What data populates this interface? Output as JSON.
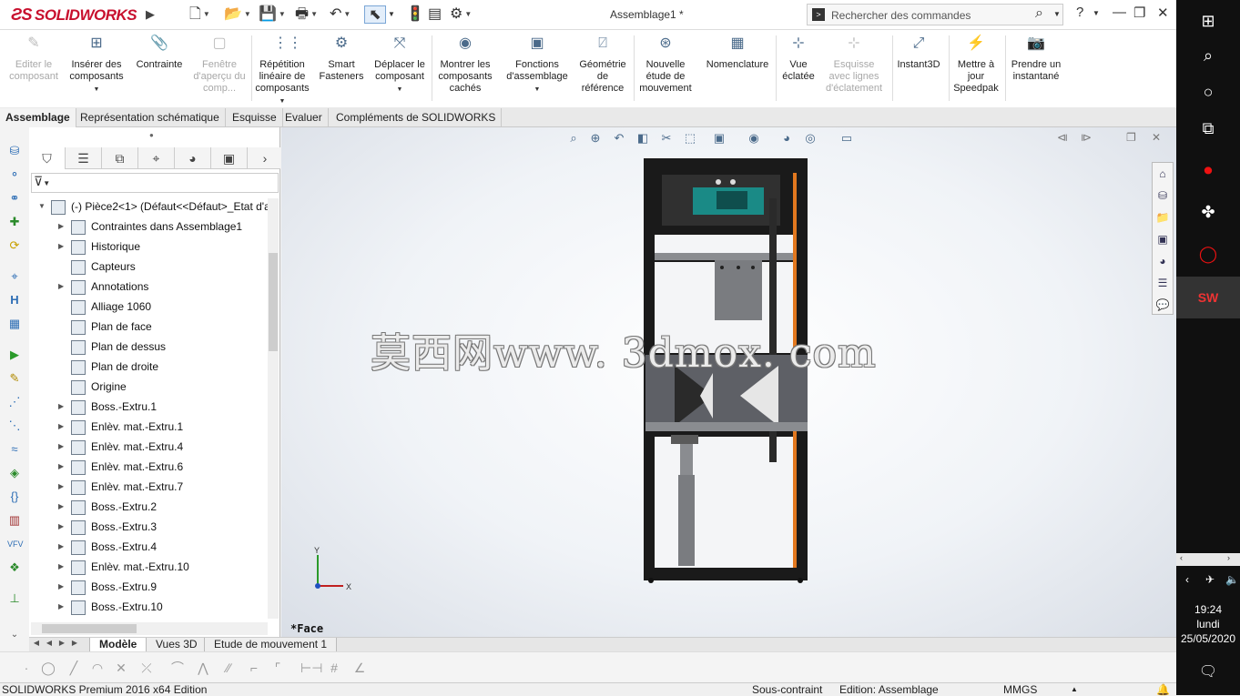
{
  "app": {
    "brand": "SOLIDWORKS",
    "document_title": "Assemblage1 *",
    "search_placeholder": "Rechercher des commandes",
    "help": "?"
  },
  "ribbon": [
    {
      "id": "edit",
      "label": "Editer le composant",
      "disabled": true
    },
    {
      "id": "insert",
      "label": "Insérer des composants",
      "disabled": false
    },
    {
      "id": "mate",
      "label": "Contrainte",
      "disabled": false
    },
    {
      "id": "preview",
      "label": "Fenêtre d'aperçu du comp...",
      "disabled": true
    },
    {
      "id": "pattern",
      "label": "Répétition linéaire de composants",
      "disabled": false
    },
    {
      "id": "fasteners",
      "label": "Smart Fasteners",
      "disabled": false
    },
    {
      "id": "move",
      "label": "Déplacer le composant",
      "disabled": false
    },
    {
      "id": "hidden",
      "label": "Montrer les composants cachés",
      "disabled": false
    },
    {
      "id": "features",
      "label": "Fonctions d'assemblage",
      "disabled": false
    },
    {
      "id": "refgeom",
      "label": "Géométrie de référence",
      "disabled": false
    },
    {
      "id": "motion",
      "label": "Nouvelle étude de mouvement",
      "disabled": false
    },
    {
      "id": "bom",
      "label": "Nomenclature",
      "disabled": false
    },
    {
      "id": "exploded",
      "label": "Vue éclatée",
      "disabled": false
    },
    {
      "id": "explodelines",
      "label": "Esquisse avec lignes d'éclatement",
      "disabled": true
    },
    {
      "id": "instant3d",
      "label": "Instant3D",
      "disabled": false
    },
    {
      "id": "speedpak",
      "label": "Mettre à jour Speedpak",
      "disabled": false
    },
    {
      "id": "snapshot",
      "label": "Prendre un instantané",
      "disabled": false
    }
  ],
  "cm_tabs": [
    "Assemblage",
    "Représentation schématique",
    "Esquisse",
    "Evaluer",
    "Compléments de SOLIDWORKS"
  ],
  "tree": {
    "root": "(-) Pièce2<1> (Défaut<<Défaut>_Etat d'a",
    "items": [
      {
        "label": "Contraintes dans Assemblage1",
        "expand": true
      },
      {
        "label": "Historique",
        "expand": true
      },
      {
        "label": "Capteurs",
        "expand": false
      },
      {
        "label": "Annotations",
        "expand": true
      },
      {
        "label": "Alliage 1060",
        "expand": false
      },
      {
        "label": "Plan de face",
        "expand": false
      },
      {
        "label": "Plan de dessus",
        "expand": false
      },
      {
        "label": "Plan de droite",
        "expand": false
      },
      {
        "label": "Origine",
        "expand": false
      },
      {
        "label": "Boss.-Extru.1",
        "expand": true
      },
      {
        "label": "Enlèv. mat.-Extru.1",
        "expand": true
      },
      {
        "label": "Enlèv. mat.-Extru.4",
        "expand": true
      },
      {
        "label": "Enlèv. mat.-Extru.6",
        "expand": true
      },
      {
        "label": "Enlèv. mat.-Extru.7",
        "expand": true
      },
      {
        "label": "Boss.-Extru.2",
        "expand": true
      },
      {
        "label": "Boss.-Extru.3",
        "expand": true
      },
      {
        "label": "Boss.-Extru.4",
        "expand": true
      },
      {
        "label": "Enlèv. mat.-Extru.10",
        "expand": true
      },
      {
        "label": "Boss.-Extru.9",
        "expand": true
      },
      {
        "label": "Boss.-Extru.10",
        "expand": true
      }
    ]
  },
  "viewport": {
    "watermark": "莫西网www. 3dmox. com",
    "view_name": "*Face",
    "axis_x": "X",
    "axis_y": "Y"
  },
  "model_tabs": [
    "Modèle",
    "Vues 3D",
    "Etude de mouvement 1"
  ],
  "status": {
    "product": "SOLIDWORKS Premium 2016 x64 Edition",
    "constraint": "Sous-contraint",
    "mode": "Edition: Assemblage",
    "units": "MMGS"
  },
  "taskbar": {
    "time": "19:24",
    "day": "lundi",
    "date": "25/05/2020"
  },
  "colors": {
    "brand": "#c8102e",
    "frame": "#1a1a1a",
    "plate": "#5e6066",
    "orange": "#e2781f",
    "motor": "#1a8a86"
  }
}
